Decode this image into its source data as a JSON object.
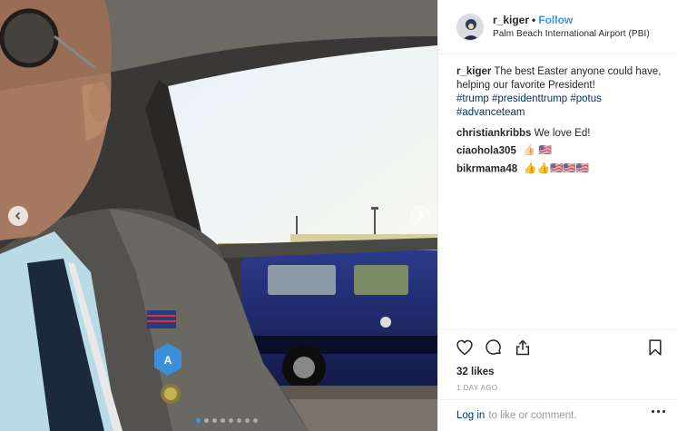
{
  "post": {
    "username": "r_kiger",
    "separator": "•",
    "follow_label": "Follow",
    "location": "Palm Beach International Airport (PBI)"
  },
  "caption": {
    "user": "r_kiger",
    "text": "The best Easter anyone could have, helping our favorite President!",
    "hashtags": [
      "#trump",
      "#presidenttrump",
      "#potus",
      "#advanceteam"
    ]
  },
  "comments": [
    {
      "user": "christiankribbs",
      "text": "We love Ed!"
    },
    {
      "user": "ciaohola305",
      "emoji": "👍🏻 🇺🇸"
    },
    {
      "user": "bikrmama48",
      "emoji": "👍👍🇺🇸🇺🇸🇺🇸"
    }
  ],
  "engagement": {
    "likes": "32 likes",
    "time": "1 DAY AGO"
  },
  "footer": {
    "login_label": "Log in",
    "suffix": "to like or comment."
  },
  "carousel": {
    "total": 8,
    "active_index": 0
  },
  "icons": {
    "like": "heart-icon",
    "comment": "comment-bubble-icon",
    "share": "share-icon",
    "save": "bookmark-icon",
    "more": "more-options-icon",
    "prev": "chevron-left-icon",
    "next": "chevron-right-icon"
  },
  "colors": {
    "link_blue": "#3897f0",
    "hashtag": "#003569",
    "muted": "#999999"
  }
}
